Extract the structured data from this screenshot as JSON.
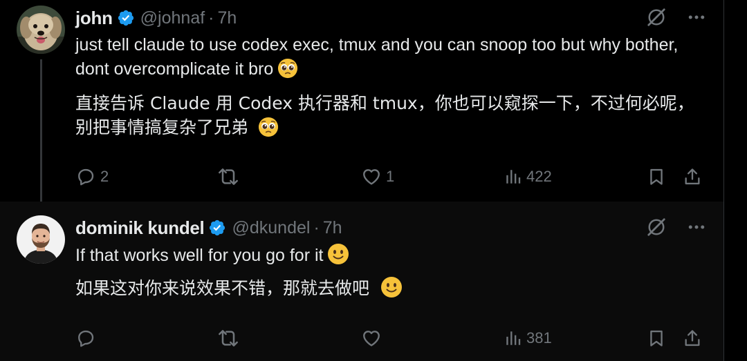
{
  "colors": {
    "background": "#000000",
    "reply_background": "#0b0b0b",
    "text_primary": "#e7e9ea",
    "text_secondary": "#71767b",
    "verified_badge": "#1d9bf0"
  },
  "tweets": [
    {
      "author": {
        "name": "john",
        "handle": "@johnaf",
        "verified": true,
        "avatar": "dog-avatar"
      },
      "time": "7h",
      "separator": "·",
      "text_en": "just tell claude to use codex exec, tmux and you can snoop too but why bother, dont overcomplicate it bro",
      "emoji_en": "pleading-face-emoji",
      "text_zh": "直接告诉 Claude 用 Codex 执行器和 tmux，你也可以窥探一下，不过何必呢，别把事情搞复杂了兄弟",
      "emoji_zh": "pleading-face-emoji",
      "stats": {
        "replies": "2",
        "retweets": "",
        "likes": "1",
        "views": "422"
      }
    },
    {
      "author": {
        "name": "dominik kundel",
        "handle": "@dkundel",
        "verified": true,
        "avatar": "person-avatar"
      },
      "time": "7h",
      "separator": "·",
      "text_en": "If that works well for you go for it",
      "emoji_en": "slightly-smiling-face-emoji",
      "text_zh": "如果这对你来说效果不错，那就去做吧",
      "emoji_zh": "slightly-smiling-face-emoji",
      "stats": {
        "replies": "",
        "retweets": "",
        "likes": "",
        "views": "381"
      }
    }
  ]
}
